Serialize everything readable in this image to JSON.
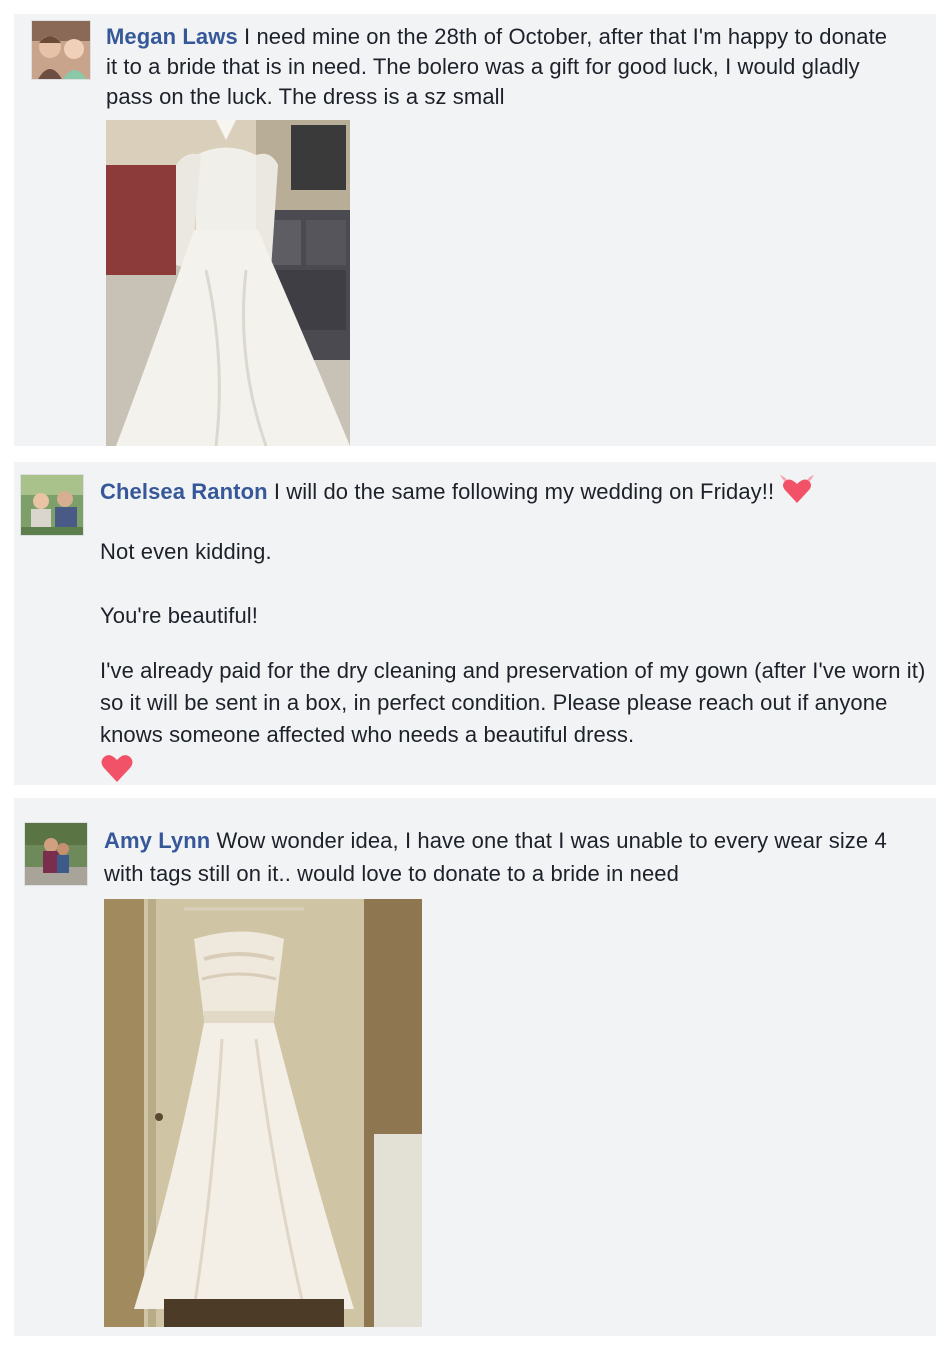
{
  "comments": [
    {
      "author": "Megan Laws",
      "text": " I need mine on the 28th of October, after that I'm happy to donate it to a bride that is in need. The bolero was a gift for good luck, I would gladly pass on the luck. The dress is a sz small",
      "photo": "wedding-dress-with-bolero-photo"
    },
    {
      "author": "Chelsea Ranton",
      "text": " I will do the same following my wedding on Friday!!",
      "paragraphs": [
        "Not even kidding.",
        "You're beautiful!",
        "I've already paid for the dry cleaning and preservation of my gown (after I've worn it) so it will be sent in a box, in perfect condition. Please please reach out if anyone knows someone affected who needs a beautiful dress."
      ],
      "icons": [
        "heart-with-wings-icon",
        "heart-icon"
      ]
    },
    {
      "author": "Amy Lynn",
      "text": " Wow wonder idea, I have one that I was unable to every wear size 4 with tags still on it.. would love to donate to a bride in need",
      "photo": "hanging-wedding-dress-photo"
    }
  ],
  "colors": {
    "author_link": "#365899",
    "comment_bg": "#f2f3f5",
    "heart": "#f25268"
  }
}
